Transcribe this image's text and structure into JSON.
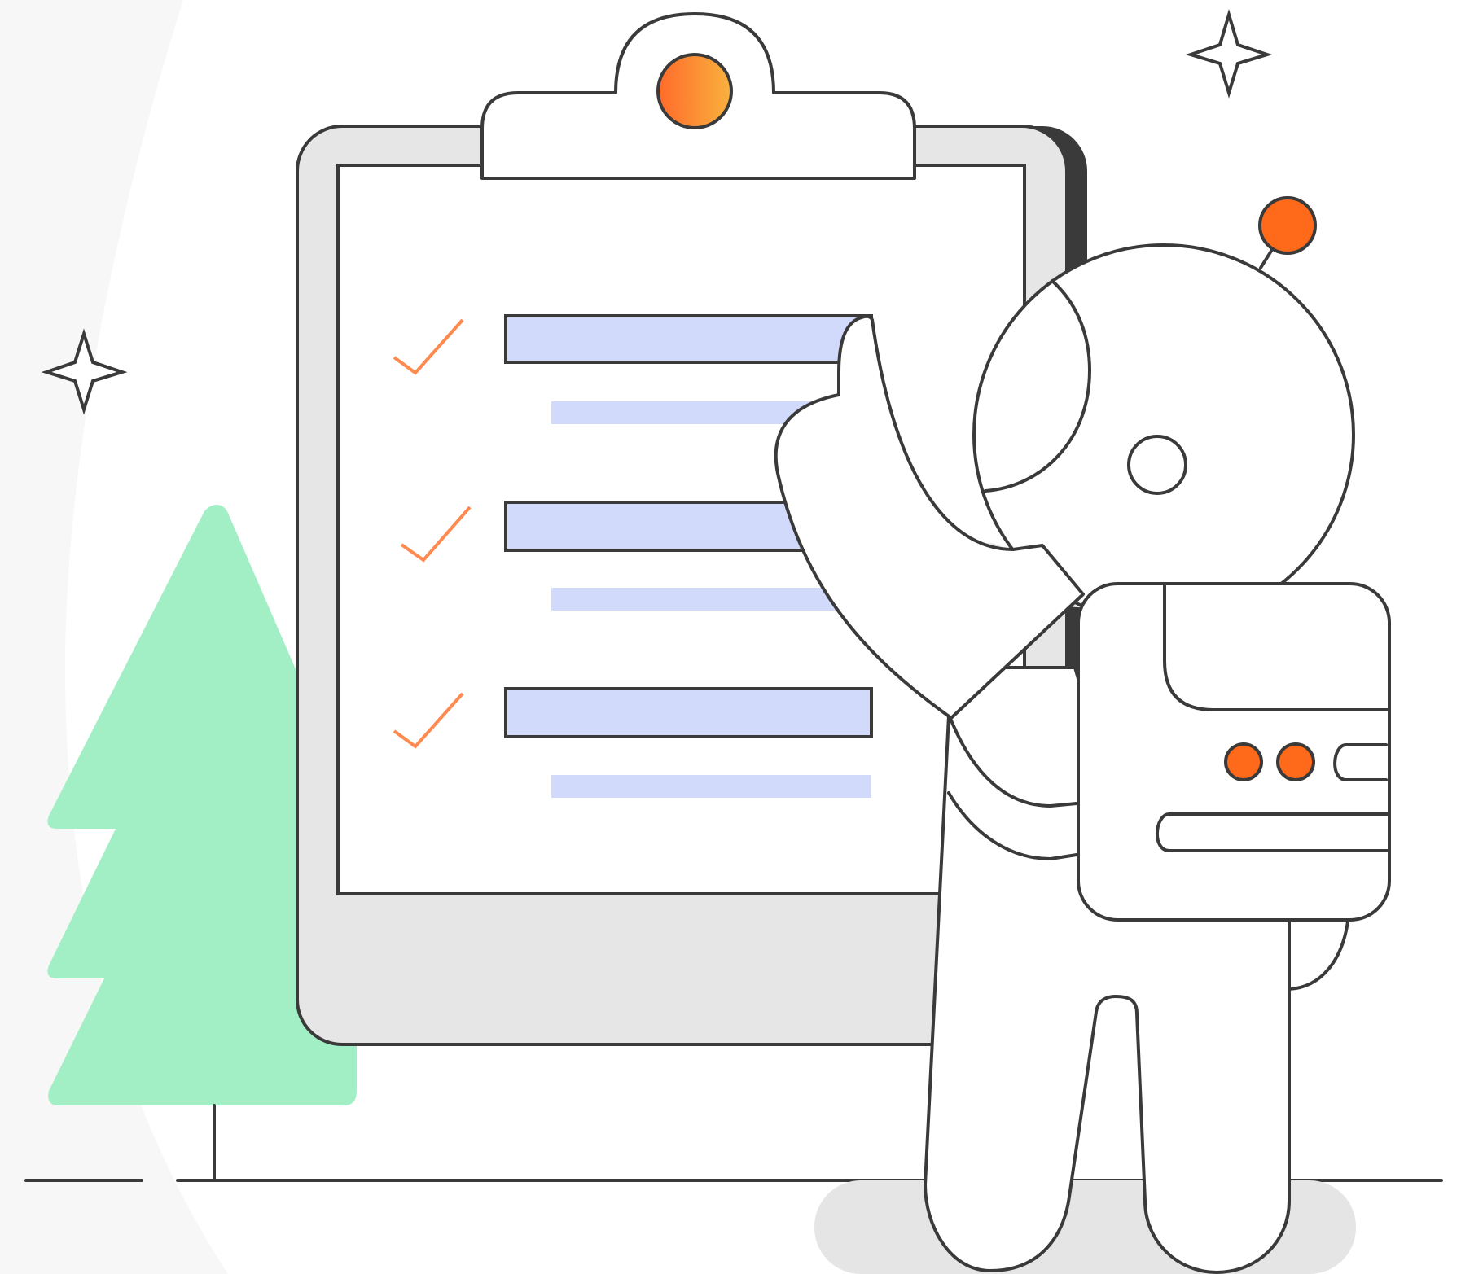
{
  "colors": {
    "background": "#ffffff",
    "background_arc": "#f7f7f7",
    "outline": "#3a3a3a",
    "clipboard_frame": "#e6e6e6",
    "clipboard_shadow": "#3a3a3a",
    "paper": "#ffffff",
    "text_line_placeholder": "#d1dafa",
    "check_mark": "#ff8a50",
    "orange_accent": "#ff6a1a",
    "clip_gradient_start": "#ff6a2a",
    "clip_gradient_end": "#f9b23e",
    "tree": "#a2eec5",
    "ground_shadow": "#e5e5e5"
  },
  "icons": {
    "sparkles": [
      "sparkle-icon",
      "sparkle-icon"
    ],
    "checks": [
      "check-icon",
      "check-icon",
      "check-icon"
    ]
  },
  "checklist": {
    "item_count": 3
  }
}
